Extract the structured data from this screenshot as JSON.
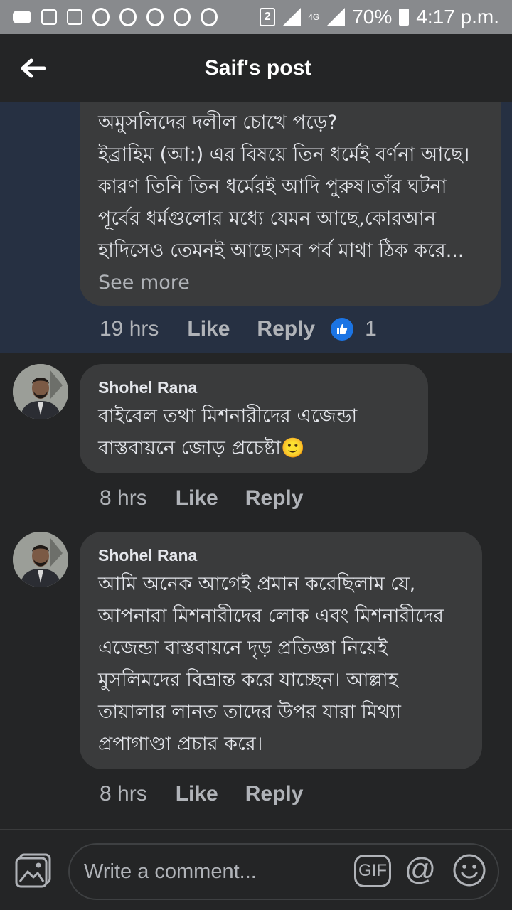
{
  "status_bar": {
    "sim_slot": "2",
    "network": "4G",
    "battery": "70%",
    "time": "4:17 p.m."
  },
  "header": {
    "title": "Saif's post"
  },
  "comments": [
    {
      "text": "অমুসলিদের দলীল চোখে পড়ে?\nইব্রাহিম (আ:) এর বিষয়ে তিন ধর্মেই বর্ণনা আছে।কারণ তিনি তিন ধর্মেরই আদি পুরুষ।তাঁর ঘটনা পূর্বের ধর্মগুলোর মধ্যে যেমন আছে,কোরআন হাদিসেও তেমনই আছে।সব পর্ব মাথা ঠিক করে...",
      "see_more": "See more",
      "time": "19 hrs",
      "like": "Like",
      "reply": "Reply",
      "reaction_count": "1"
    },
    {
      "author": "Shohel Rana",
      "text": "বাইবেল তথা মিশনারীদের এজেন্ডা বাস্তবায়নে জোড় প্রচেষ্টা🙂",
      "time": "8 hrs",
      "like": "Like",
      "reply": "Reply"
    },
    {
      "author": "Shohel Rana",
      "text": "আমি অনেক আগেই প্রমান করেছিলাম যে, আপনারা মিশনারীদের লোক এবং মিশনারীদের এজেন্ডা বাস্তবায়নে দৃড় প্রতিজ্ঞা নিয়েই মুসলিমদের বিভ্রান্ত করে যাচ্ছেন। আল্লাহ তায়ালার লানত তাদের উপর যারা মিথ্যা প্রপাগাণ্ডা প্রচার করে।",
      "time": "8 hrs",
      "like": "Like",
      "reply": "Reply"
    }
  ],
  "composer": {
    "placeholder": "Write a comment...",
    "gif_label": "GIF",
    "at_label": "@"
  },
  "colors": {
    "background": "#242526",
    "bubble": "#3a3b3c",
    "highlight": "#263042",
    "secondary_text": "#b0b3b8",
    "like_blue": "#1b74e4"
  },
  "icons": [
    "menu-dots-icon",
    "image-icon",
    "recycle-icon",
    "sim-icon",
    "signal-icon",
    "battery-icon",
    "back-arrow-icon",
    "thumbs-up-icon",
    "photo-icon",
    "gif-icon",
    "mention-icon",
    "emoji-icon"
  ]
}
